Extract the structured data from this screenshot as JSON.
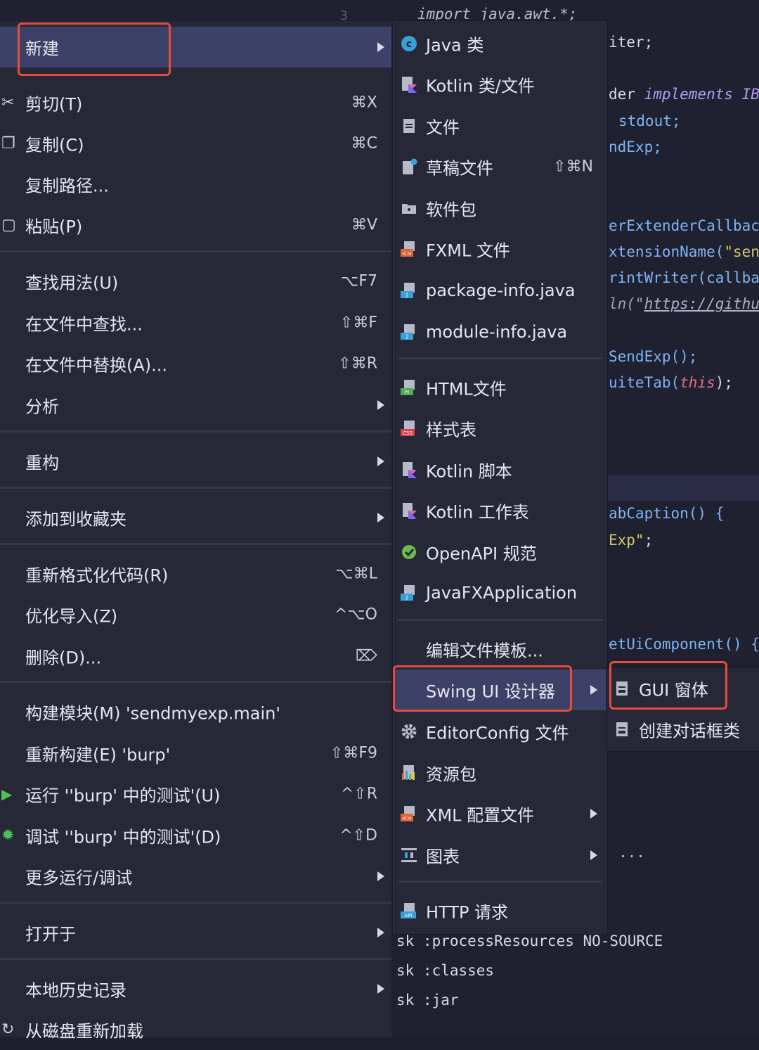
{
  "editor": {
    "gutter_number": "3",
    "code_lines": {
      "import": "import java.awt.*;",
      "l1": "iter;",
      "l2a": "der ",
      "l2b": "implements",
      "l2c": " IB",
      "l3": "stdout;",
      "l4": "ndExp;",
      "l5": "erExtenderCallbac",
      "l6a": "xtensionName(",
      "l6b": "\"sen",
      "l7": "rintWriter(callba",
      "l8a": "ln(\"",
      "l8b": "https://githu",
      "l9": "SendExp();",
      "l10a": "uiteTab(",
      "l10b": "this",
      "l10c": ");",
      "l11": "abCaption() {",
      "l12a": "Exp\"",
      "l12b": ";",
      "l13": "etUiComponent() {",
      "dots": "...",
      "t1": "sk :processResources NO-SOURCE",
      "t2": "sk :classes",
      "t3": "sk :jar"
    }
  },
  "main_menu": {
    "items": [
      {
        "label": "新建",
        "shortcut": "",
        "submenu": true,
        "selected": true
      },
      {
        "label": "剪切(T)",
        "shortcut": "⌘X",
        "icon": "scissors-icon"
      },
      {
        "label": "复制(C)",
        "shortcut": "⌘C",
        "icon": "copy-icon"
      },
      {
        "label": "复制路径...",
        "shortcut": ""
      },
      {
        "label": "粘贴(P)",
        "shortcut": "⌘V",
        "icon": "paste-icon"
      },
      {
        "label": "查找用法(U)",
        "shortcut": "⌥F7"
      },
      {
        "label": "在文件中查找...",
        "shortcut": "⇧⌘F"
      },
      {
        "label": "在文件中替换(A)...",
        "shortcut": "⇧⌘R"
      },
      {
        "label": "分析",
        "submenu": true
      },
      {
        "label": "重构",
        "submenu": true
      },
      {
        "label": "添加到收藏夹",
        "submenu": true
      },
      {
        "label": "重新格式化代码(R)",
        "shortcut": "⌥⌘L"
      },
      {
        "label": "优化导入(Z)",
        "shortcut": "^⌥O"
      },
      {
        "label": "删除(D)...",
        "shortcut": "⌦"
      },
      {
        "label": "构建模块(M) 'sendmyexp.main'",
        "shortcut": ""
      },
      {
        "label": "重新构建(E) 'burp'",
        "shortcut": "⇧⌘F9"
      },
      {
        "label": "运行 ''burp' 中的测试'(U)",
        "shortcut": "^⇧R",
        "icon": "run-icon"
      },
      {
        "label": "调试 ''burp' 中的测试'(D)",
        "shortcut": "^⇧D",
        "icon": "debug-icon"
      },
      {
        "label": "更多运行/调试",
        "submenu": true
      },
      {
        "label": "打开于",
        "submenu": true
      },
      {
        "label": "本地历史记录",
        "submenu": true
      },
      {
        "label": "从磁盘重新加载",
        "icon": "reload-icon"
      }
    ]
  },
  "new_submenu": {
    "items": [
      {
        "label": "Java 类",
        "icon": "java-class-icon"
      },
      {
        "label": "Kotlin 类/文件",
        "icon": "kotlin-file-icon"
      },
      {
        "label": "文件",
        "icon": "file-icon"
      },
      {
        "label": "草稿文件",
        "shortcut": "⇧⌘N",
        "icon": "scratch-file-icon"
      },
      {
        "label": "软件包",
        "icon": "package-icon"
      },
      {
        "label": "FXML 文件",
        "icon": "fxml-icon"
      },
      {
        "label": "package-info.java",
        "icon": "java-file-icon"
      },
      {
        "label": "module-info.java",
        "icon": "java-file-icon"
      },
      {
        "label": "HTML文件",
        "icon": "html-icon"
      },
      {
        "label": "样式表",
        "icon": "css-icon"
      },
      {
        "label": "Kotlin 脚本",
        "icon": "kotlin-script-icon"
      },
      {
        "label": "Kotlin 工作表",
        "icon": "kotlin-worksheet-icon"
      },
      {
        "label": "OpenAPI 规范",
        "icon": "openapi-icon"
      },
      {
        "label": "JavaFXApplication",
        "icon": "javafx-icon"
      },
      {
        "label": "编辑文件模板...",
        "icon": ""
      },
      {
        "label": "Swing UI 设计器",
        "submenu": true,
        "selected": true
      },
      {
        "label": "EditorConfig 文件",
        "icon": "gear-icon"
      },
      {
        "label": "资源包",
        "icon": "resource-bundle-icon"
      },
      {
        "label": "XML 配置文件",
        "submenu": true,
        "icon": "xml-icon"
      },
      {
        "label": "图表",
        "submenu": true,
        "icon": "diagram-icon"
      },
      {
        "label": "HTTP 请求",
        "icon": "http-request-icon"
      }
    ]
  },
  "swing_submenu": {
    "items": [
      {
        "label": "GUI 窗体",
        "icon": "form-icon"
      },
      {
        "label": "创建对话框类",
        "icon": "dialog-icon"
      }
    ]
  },
  "colors": {
    "menu_bg": "#262838",
    "selected_bg": "#3d4167",
    "highlight_box": "#e84a3c",
    "editor_bg": "#1f2030"
  }
}
